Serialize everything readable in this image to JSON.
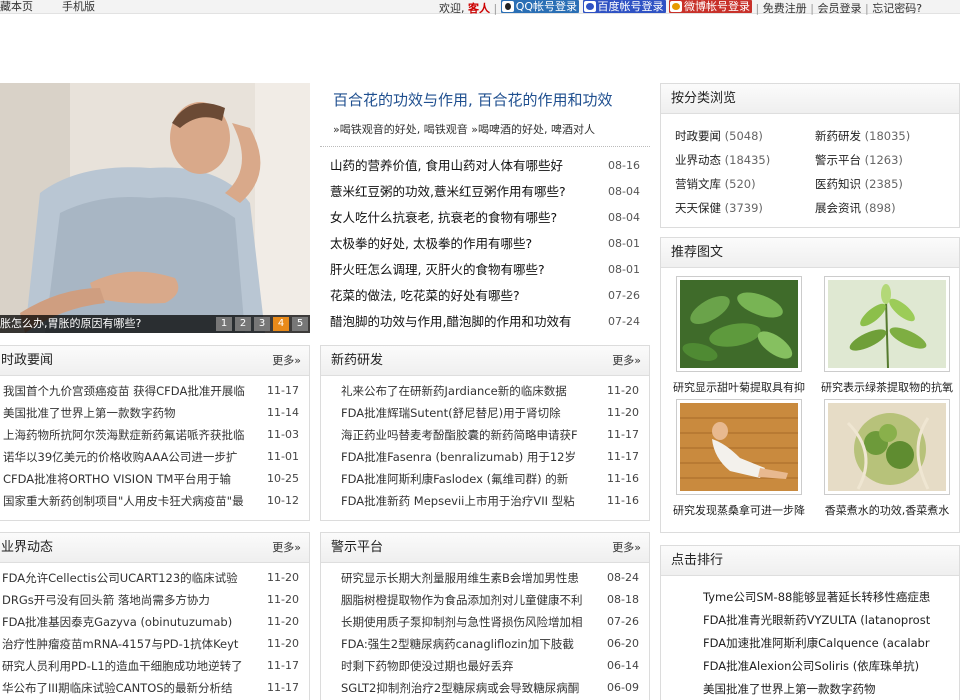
{
  "topbar": {
    "left": [
      "藏本页",
      "手机版"
    ],
    "welcome": "欢迎,",
    "guest": "客人",
    "qq_login": "QQ帐号登录",
    "baidu_login": "百度帐号登录",
    "weibo_login": "微博帐号登录",
    "register": "免费注册",
    "member_login": "会员登录",
    "forgot": "忘记密码?"
  },
  "slider": {
    "caption": "胀怎么办,胃胀的原因有哪些?",
    "pages": [
      "1",
      "2",
      "3",
      "4",
      "5"
    ],
    "active_page": "4"
  },
  "headline": {
    "title": "百合花的功效与作用, 百合花的作用和功效",
    "hot": "»喝铁观音的好处, 喝铁观音 »喝啤酒的好处, 啤酒对人"
  },
  "top_news": [
    {
      "title": "山药的营养价值, 食用山药对人体有哪些好",
      "date": "08-16"
    },
    {
      "title": "薏米红豆粥的功效,薏米红豆粥作用有哪些?",
      "date": "08-04"
    },
    {
      "title": "女人吃什么抗衰老, 抗衰老的食物有哪些?",
      "date": "08-04"
    },
    {
      "title": "太极拳的好处, 太极拳的作用有哪些?",
      "date": "08-01"
    },
    {
      "title": "肝火旺怎么调理, 灭肝火的食物有哪些?",
      "date": "08-01"
    },
    {
      "title": "花菜的做法, 吃花菜的好处有哪些?",
      "date": "07-26"
    },
    {
      "title": "醋泡脚的功效与作用,醋泡脚的作用和功效有",
      "date": "07-24"
    }
  ],
  "panels": {
    "policy": {
      "title": "时政要闻",
      "more": "更多»",
      "items": [
        {
          "title": "我国首个九价宫颈癌疫苗 获得CFDA批准开展临",
          "date": "11-17"
        },
        {
          "title": "美国批准了世界上第一款数字药物",
          "date": "11-14"
        },
        {
          "title": "上海药物所抗阿尔茨海默症新药氟诺哌齐获批临",
          "date": "11-03"
        },
        {
          "title": "诺华以39亿美元的价格收购AAA公司进一步扩",
          "date": "11-01"
        },
        {
          "title": "CFDA批准将ORTHO VISION TM平台用于输",
          "date": "10-25"
        },
        {
          "title": "国家重大新药创制项目\"人用皮卡狂犬病疫苗\"最",
          "date": "10-12"
        }
      ]
    },
    "rnd": {
      "title": "新药研发",
      "more": "更多»",
      "items": [
        {
          "title": "礼来公布了在研新药Jardiance新的临床数据",
          "date": "11-20"
        },
        {
          "title": "FDA批准辉瑞Sutent(舒尼替尼)用于肾切除",
          "date": "11-20"
        },
        {
          "title": "海正药业吗替麦考酚酯胶囊的新药简略申请获F",
          "date": "11-17"
        },
        {
          "title": "FDA批准Fasenra (benralizumab) 用于12岁",
          "date": "11-17"
        },
        {
          "title": "FDA批准阿斯利康Faslodex (氟维司群) 的新",
          "date": "11-16"
        },
        {
          "title": "FDA批准新药 Mepsevii上市用于治疗VII 型粘",
          "date": "11-16"
        }
      ]
    },
    "industry": {
      "title": "业界动态",
      "more": "更多»",
      "items": [
        {
          "title": "FDA允许Cellectis公司UCART123的临床试验",
          "date": "11-20"
        },
        {
          "title": "DRGs开弓没有回头箭 落地尚需多方协力",
          "date": "11-20"
        },
        {
          "title": "FDA批准基因泰克Gazyva (obinutuzumab)",
          "date": "11-20"
        },
        {
          "title": "治疗性肿瘤疫苗mRNA-4157与PD-1抗体Keyt",
          "date": "11-20"
        },
        {
          "title": "研究人员利用PD-L1的造血干细胞成功地逆转了",
          "date": "11-17"
        },
        {
          "title": "华公布了III期临床试验CANTOS的最新分析结",
          "date": "11-17"
        }
      ]
    },
    "warning": {
      "title": "警示平台",
      "more": "更多»",
      "items": [
        {
          "title": "研究显示长期大剂量服用维生素B会增加男性患",
          "date": "08-24"
        },
        {
          "title": "胭脂树橙提取物作为食品添加剂对儿童健康不利",
          "date": "08-18"
        },
        {
          "title": "长期使用质子泵抑制剂与急性肾损伤风险增加相",
          "date": "07-26"
        },
        {
          "title": "FDA:强生2型糖尿病药canagliflozin加下肢截",
          "date": "06-20"
        },
        {
          "title": "时剩下药物即使没过期也最好丢弃",
          "date": "06-14"
        },
        {
          "title": "SGLT2抑制剂治疗2型糖尿病或会导致糖尿病酮",
          "date": "06-09"
        }
      ]
    }
  },
  "categories": {
    "title": "按分类浏览",
    "items": [
      {
        "name": "时政要闻",
        "count": "(5048)"
      },
      {
        "name": "新药研发",
        "count": "(18035)"
      },
      {
        "name": "业界动态",
        "count": "(18435)"
      },
      {
        "name": "警示平台",
        "count": "(1263)"
      },
      {
        "name": "营销文库",
        "count": "(520)"
      },
      {
        "name": "医药知识",
        "count": "(2385)"
      },
      {
        "name": "天天保健",
        "count": "(3739)"
      },
      {
        "name": "展会资讯",
        "count": "(898)"
      }
    ]
  },
  "recommend": {
    "title": "推荐图文",
    "items": [
      {
        "caption": "研究显示甜叶菊提取具有抑"
      },
      {
        "caption": "研究表示绿茶提取物的抗氧"
      },
      {
        "caption": "研究发现蒸桑拿可进一步降"
      },
      {
        "caption": "香菜煮水的功效,香菜煮水"
      }
    ]
  },
  "ranking": {
    "title": "点击排行",
    "items": [
      "Tyme公司SM-88能够显著延长转移性癌症患",
      "FDA批准青光眼新药VYZULTA (latanoprost",
      "FDA加速批准阿斯利康Calquence (acalabr",
      "FDA批准Alexion公司Soliris (依库珠单抗)",
      "美国批准了世界上第一款数字药物"
    ]
  },
  "colors": {
    "headline": "#1f4f8f",
    "guest": "#cc0000",
    "active_page": "#e88a1a",
    "qq": "#2a6fb5",
    "baidu": "#2f52c4",
    "weibo": "#c8312a"
  }
}
